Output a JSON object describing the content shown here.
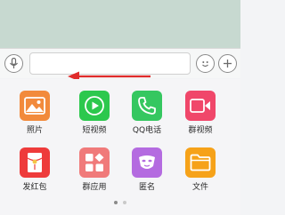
{
  "colors": {
    "chat_bg": "#c7d9d0",
    "photo": "#f28a3c",
    "video": "#2cc84d",
    "qq_call": "#35c760",
    "group_video": "#f0476a",
    "red_packet": "#ee3b3b",
    "group_app": "#f07a7a",
    "anonymous": "#b46be0",
    "file": "#f6a219",
    "arrow": "#e02b2b"
  },
  "input_bar": {
    "voice_icon": "microphone-icon",
    "emoji_icon": "smile-icon",
    "plus_icon": "plus-icon",
    "text_value": ""
  },
  "apps": [
    {
      "label": "照片",
      "icon": "image-icon"
    },
    {
      "label": "短视频",
      "icon": "play-icon"
    },
    {
      "label": "QQ电话",
      "icon": "phone-icon"
    },
    {
      "label": "群视频",
      "icon": "video-camera-icon"
    },
    {
      "label": "发红包",
      "icon": "red-packet-icon"
    },
    {
      "label": "群应用",
      "icon": "app-grid-icon"
    },
    {
      "label": "匿名",
      "icon": "mask-icon"
    },
    {
      "label": "文件",
      "icon": "folder-icon"
    }
  ],
  "pager": {
    "pages": 2,
    "current": 1
  }
}
